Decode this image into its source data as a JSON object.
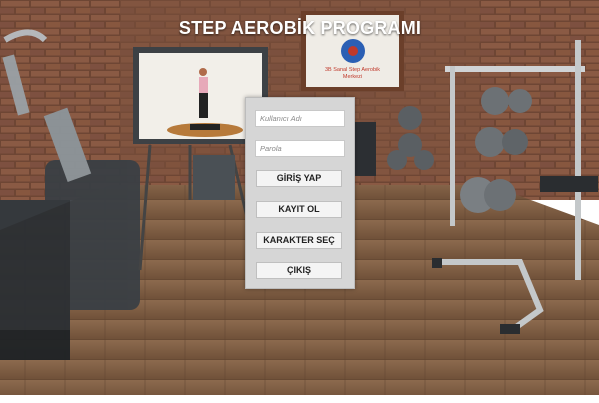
{
  "title": "STEP AEROBİK PROGRAMI",
  "sign": {
    "text_line1": "3B Sanal Step Aerobik",
    "text_line2": "Merkezi"
  },
  "form": {
    "username_placeholder": "Kullanıcı Adı",
    "password_placeholder": "Parola",
    "login_label": "GİRİŞ YAP",
    "register_label": "KAYIT OL",
    "character_label": "KARAKTER SEÇ",
    "exit_label": "ÇIKIŞ"
  }
}
